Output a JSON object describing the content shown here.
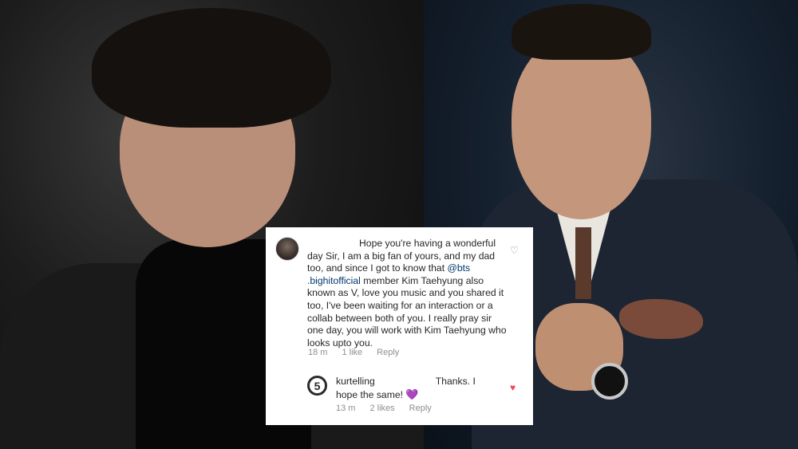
{
  "comment": {
    "text_before": "Hope you're having a wonderful day Sir, I am a big fan of yours, and my dad too, and since I got to know that ",
    "mention": "@bts .bighitofficial",
    "text_after": " member Kim Taehyung also known as V, love you music and you shared it too, I've been waiting for an interaction or a collab between both of you. I really pray sir one day, you will work with Kim Taehyung who looks upto you.",
    "time": "18 m",
    "likes": "1 like",
    "reply_label": "Reply",
    "like_icon": "heart-outline-icon"
  },
  "reply": {
    "avatar_letter": "5",
    "username": "kurtelling",
    "text": "Thanks. I hope the same!",
    "emoji": "💜",
    "time": "13 m",
    "likes": "2 likes",
    "reply_label": "Reply",
    "like_icon": "heart-filled-icon",
    "like_color": "#ed4956"
  },
  "colors": {
    "mention": "#00376b",
    "meta": "#8e8e8e",
    "text": "#262626"
  }
}
